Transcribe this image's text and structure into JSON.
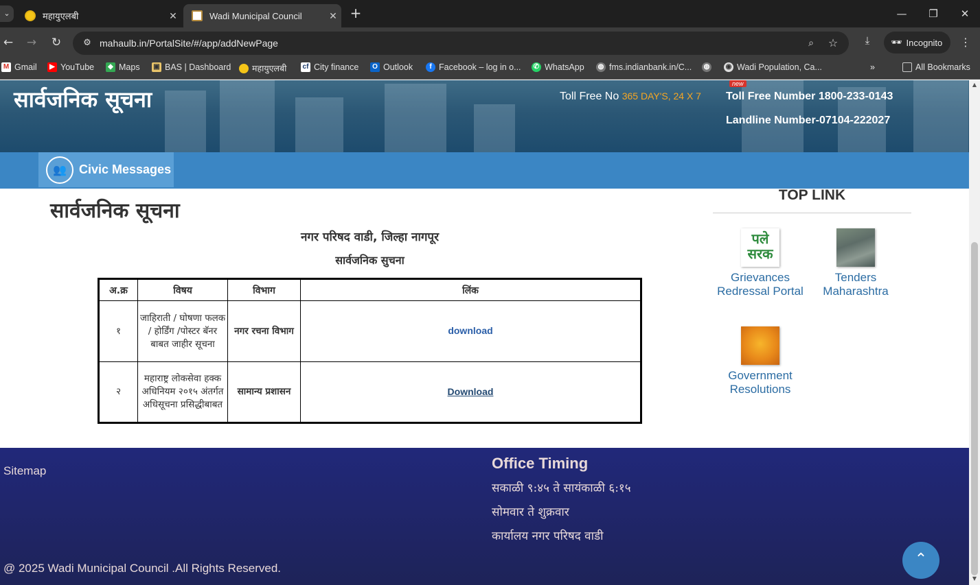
{
  "browser": {
    "tabs": [
      {
        "title": "महायुएलबी",
        "icon": "gold-emblem-icon",
        "active": false
      },
      {
        "title": "Wadi Municipal Council",
        "icon": "council-logo-icon",
        "active": true
      }
    ],
    "url": "mahaulb.in/PortalSite/#/app/addNewPage",
    "incognito_label": "Incognito",
    "bookmarks": [
      {
        "label": "Gmail",
        "icon": "gmail-icon"
      },
      {
        "label": "YouTube",
        "icon": "youtube-icon"
      },
      {
        "label": "Maps",
        "icon": "maps-icon"
      },
      {
        "label": "BAS | Dashboard",
        "icon": "bas-icon"
      },
      {
        "label": "महायुएलबी",
        "icon": "gold-emblem-icon"
      },
      {
        "label": "City finance",
        "icon": "cityfinance-icon"
      },
      {
        "label": "Outlook",
        "icon": "outlook-icon"
      },
      {
        "label": "Facebook – log in o...",
        "icon": "facebook-icon"
      },
      {
        "label": "WhatsApp",
        "icon": "whatsapp-icon"
      },
      {
        "label": "fms.indianbank.in/C...",
        "icon": "globe-icon"
      },
      {
        "label": "",
        "icon": "globe-icon"
      },
      {
        "label": "Wadi Population, Ca...",
        "icon": "globe-icon"
      }
    ],
    "all_bookmarks_label": "All Bookmarks"
  },
  "header": {
    "title": "सार्वजनिक सूचना",
    "toll_free_label": "Toll Free No",
    "toll_free_days": "365 DAY'S, 24 X 7",
    "new_badge": "new",
    "toll_free_number": "Toll Free Number 1800-233-0143",
    "landline": "Landline Number-07104-222027"
  },
  "nav": {
    "civic_messages": "Civic Messages"
  },
  "main": {
    "heading": "सार्वजनिक सूचना",
    "subtitle1": "नगर परिषद वाडी, जिल्हा नागपूर",
    "subtitle2": "सार्वजनिक सुचना",
    "table": {
      "headers": [
        "अ.क्र",
        "विषय",
        "विभाग",
        "लिंक"
      ],
      "rows": [
        {
          "no": "१",
          "subject": "जाहिराती / घोषणा फलक / होर्डिंग /पोस्टर बॅनर बाबत जाहीर सूचना",
          "dept": "नगर रचना विभाग",
          "link": "download"
        },
        {
          "no": "२",
          "subject": "महाराष्ट्र लोकसेवा हक्क अधिनियम २०१५ अंतर्गत अधिसूचना प्रसिद्धीबाबत",
          "dept": "सामान्य प्रशासन",
          "link": "Download"
        }
      ]
    }
  },
  "toplinks": {
    "title": "TOP LINK",
    "items": [
      {
        "label": "Grievances Redressal Portal",
        "thumb_text": "पले सरक"
      },
      {
        "label": "Tenders Maharashtra"
      },
      {
        "label": "Government Resolutions"
      }
    ]
  },
  "footer": {
    "sitemap": "Sitemap",
    "office_title": "Office Timing",
    "office_lines": [
      "सकाळी ९:४५ ते सायंकाळी ६:१५",
      "सोमवार ते शुक्रवार",
      "कार्यालय नगर परिषद वाडी"
    ],
    "copyright": "@ 2025 Wadi Municipal Council .All Rights Reserved."
  },
  "colors": {
    "nav_band": "#3b86c4",
    "footer_bg": "#21287a",
    "link_blue": "#2b6ca3",
    "toll_accent": "#f5a623"
  }
}
